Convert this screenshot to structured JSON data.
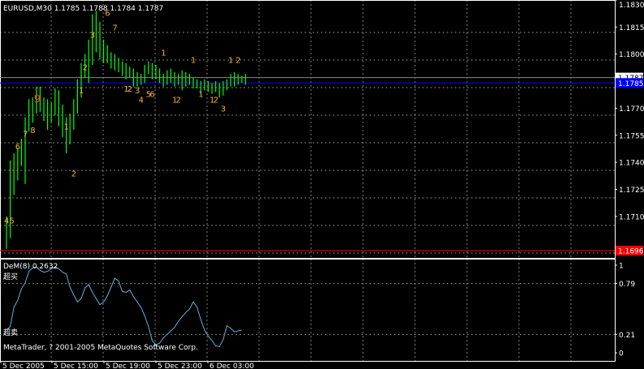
{
  "chart_data": [
    {
      "type": "line",
      "title": "EURUSD,M30  1.1785 1.1788 1.1784 1.1787",
      "ylim": [
        1.1687,
        1.183
      ],
      "y_ticks": [
        "1.1830",
        "1.1815",
        "1.1800",
        "1.1787",
        "1.1785",
        "1.1770",
        "1.1755",
        "1.1740",
        "1.1725",
        "1.1710",
        "1.1696"
      ],
      "current_price": 1.1787,
      "current_price_label": "1.1787",
      "blue_line": 1.1784,
      "blue_line_label": "1.1785",
      "red_line": 1.1691,
      "red_line_label": "1.1696",
      "bars": [
        {
          "h": 1.171,
          "l": 1.1692
        },
        {
          "h": 1.1741,
          "l": 1.1698
        },
        {
          "h": 1.1745,
          "l": 1.1722
        },
        {
          "h": 1.1748,
          "l": 1.173
        },
        {
          "h": 1.1753,
          "l": 1.1738
        },
        {
          "h": 1.1765,
          "l": 1.1728
        },
        {
          "h": 1.1775,
          "l": 1.1757
        },
        {
          "h": 1.1776,
          "l": 1.1762
        },
        {
          "h": 1.1782,
          "l": 1.1767
        },
        {
          "h": 1.1782,
          "l": 1.1768
        },
        {
          "h": 1.1776,
          "l": 1.1763
        },
        {
          "h": 1.1775,
          "l": 1.1758
        },
        {
          "h": 1.1773,
          "l": 1.1762
        },
        {
          "h": 1.1781,
          "l": 1.1766
        },
        {
          "h": 1.178,
          "l": 1.176
        },
        {
          "h": 1.1772,
          "l": 1.1754
        },
        {
          "h": 1.1765,
          "l": 1.1745
        },
        {
          "h": 1.1767,
          "l": 1.175
        },
        {
          "h": 1.1775,
          "l": 1.1758
        },
        {
          "h": 1.1786,
          "l": 1.1767
        },
        {
          "h": 1.1795,
          "l": 1.1776
        },
        {
          "h": 1.18,
          "l": 1.1787
        },
        {
          "h": 1.1808,
          "l": 1.1784
        },
        {
          "h": 1.1822,
          "l": 1.1794
        },
        {
          "h": 1.1824,
          "l": 1.1801
        },
        {
          "h": 1.1818,
          "l": 1.1797
        },
        {
          "h": 1.1808,
          "l": 1.1795
        },
        {
          "h": 1.1805,
          "l": 1.1795
        },
        {
          "h": 1.1801,
          "l": 1.1792
        },
        {
          "h": 1.18,
          "l": 1.1791
        },
        {
          "h": 1.1798,
          "l": 1.179
        },
        {
          "h": 1.1796,
          "l": 1.1788
        },
        {
          "h": 1.1795,
          "l": 1.1786
        },
        {
          "h": 1.1793,
          "l": 1.1787
        },
        {
          "h": 1.1792,
          "l": 1.1782
        },
        {
          "h": 1.179,
          "l": 1.1782
        },
        {
          "h": 1.1789,
          "l": 1.1783
        },
        {
          "h": 1.1794,
          "l": 1.1784
        },
        {
          "h": 1.1796,
          "l": 1.1789
        },
        {
          "h": 1.1795,
          "l": 1.1786
        },
        {
          "h": 1.1794,
          "l": 1.1786
        },
        {
          "h": 1.1792,
          "l": 1.1784
        },
        {
          "h": 1.1789,
          "l": 1.1782
        },
        {
          "h": 1.1791,
          "l": 1.1783
        },
        {
          "h": 1.1792,
          "l": 1.1784
        },
        {
          "h": 1.179,
          "l": 1.1782
        },
        {
          "h": 1.1789,
          "l": 1.1783
        },
        {
          "h": 1.1791,
          "l": 1.178
        },
        {
          "h": 1.179,
          "l": 1.1782
        },
        {
          "h": 1.1789,
          "l": 1.1783
        },
        {
          "h": 1.1787,
          "l": 1.1781
        },
        {
          "h": 1.1786,
          "l": 1.1781
        },
        {
          "h": 1.1785,
          "l": 1.1778
        },
        {
          "h": 1.1786,
          "l": 1.178
        },
        {
          "h": 1.1785,
          "l": 1.1779
        },
        {
          "h": 1.1784,
          "l": 1.1778
        },
        {
          "h": 1.1785,
          "l": 1.1779
        },
        {
          "h": 1.1784,
          "l": 1.1776
        },
        {
          "h": 1.1785,
          "l": 1.1777
        },
        {
          "h": 1.1786,
          "l": 1.178
        },
        {
          "h": 1.1789,
          "l": 1.1782
        },
        {
          "h": 1.179,
          "l": 1.1782
        },
        {
          "h": 1.1789,
          "l": 1.1783
        },
        {
          "h": 1.1788,
          "l": 1.1784
        },
        {
          "h": 1.1789,
          "l": 1.1783
        }
      ],
      "counts": [
        {
          "text": "45",
          "bar": 0,
          "level": 1.1708
        },
        {
          "text": "6",
          "bar": 3,
          "level": 1.1749
        },
        {
          "text": "7",
          "bar": 5,
          "level": 1.1756
        },
        {
          "text": "8",
          "bar": 7,
          "level": 1.1758
        },
        {
          "text": "9",
          "bar": 8,
          "level": 1.1775,
          "red": true
        },
        {
          "text": "1",
          "bar": 16,
          "level": 1.176
        },
        {
          "text": "2",
          "bar": 18,
          "level": 1.1734
        },
        {
          "text": "1",
          "bar": 20,
          "level": 1.178
        },
        {
          "text": "2",
          "bar": 21,
          "level": 1.1793
        },
        {
          "text": "3",
          "bar": 23,
          "level": 1.1811
        },
        {
          "text": "6",
          "bar": 27,
          "level": 1.1823
        },
        {
          "text": "7",
          "bar": 29,
          "level": 1.1815
        },
        {
          "text": "1",
          "bar": 32,
          "level": 1.1781
        },
        {
          "text": "2",
          "bar": 33,
          "level": 1.1781
        },
        {
          "text": "3",
          "bar": 35,
          "level": 1.178
        },
        {
          "text": "4",
          "bar": 36,
          "level": 1.1775
        },
        {
          "text": "5",
          "bar": 38,
          "level": 1.1778
        },
        {
          "text": "6",
          "bar": 39,
          "level": 1.1778
        },
        {
          "text": "1",
          "bar": 42,
          "level": 1.1801
        },
        {
          "text": "1",
          "bar": 45,
          "level": 1.1775
        },
        {
          "text": "2",
          "bar": 46,
          "level": 1.1775
        },
        {
          "text": "1",
          "bar": 50,
          "level": 1.1797
        },
        {
          "text": "1",
          "bar": 52,
          "level": 1.1778
        },
        {
          "text": "1",
          "bar": 55,
          "level": 1.1775
        },
        {
          "text": "2",
          "bar": 56,
          "level": 1.1775
        },
        {
          "text": "3",
          "bar": 58,
          "level": 1.177
        },
        {
          "text": "1",
          "bar": 60,
          "level": 1.1797
        },
        {
          "text": "2",
          "bar": 62,
          "level": 1.1797
        }
      ],
      "x_ticks": [
        "5 Dec 2005",
        "5 Dec 15:00",
        "5 Dec 19:00",
        "5 Dec 23:00",
        "6 Dec 03:00"
      ],
      "grid": true
    },
    {
      "type": "line",
      "title": "DeM(8) 0.2632",
      "ylim": [
        0,
        1
      ],
      "y_ticks": [
        "1",
        "0.79",
        "0.21",
        "0"
      ],
      "upper_label": "超买",
      "lower_label": "超卖",
      "series": [
        {
          "values": [
            0.26,
            0.3,
            0.52,
            0.6,
            0.73,
            0.8,
            0.93,
            0.97,
            0.98,
            0.94,
            0.92,
            0.93,
            0.96,
            0.98,
            0.96,
            0.92,
            0.9,
            0.75,
            0.66,
            0.58,
            0.62,
            0.74,
            0.78,
            0.69,
            0.62,
            0.55,
            0.58,
            0.65,
            0.75,
            0.85,
            0.82,
            0.7,
            0.69,
            0.72,
            0.64,
            0.58,
            0.52,
            0.42,
            0.3,
            0.14,
            0.09,
            0.11,
            0.17,
            0.21,
            0.25,
            0.29,
            0.36,
            0.41,
            0.46,
            0.5,
            0.58,
            0.52,
            0.38,
            0.26,
            0.19,
            0.14,
            0.08,
            0.07,
            0.15,
            0.31,
            0.28,
            0.24,
            0.25,
            0.26
          ]
        }
      ]
    }
  ],
  "copyright": "MetaTrader, ? 2001-2005 MetaQuotes Software Corp.",
  "colors": {
    "background": "#000000",
    "grid": "#808080",
    "bar": "#00ff00",
    "count": "#f5b133",
    "count_red": "#ff3b2f",
    "blue_line": "#0000ff",
    "red_line": "#ff0000",
    "dem": "#5fb4dc",
    "price_tag_bg": "#ffffff",
    "price_tag_fg": "#000000"
  }
}
